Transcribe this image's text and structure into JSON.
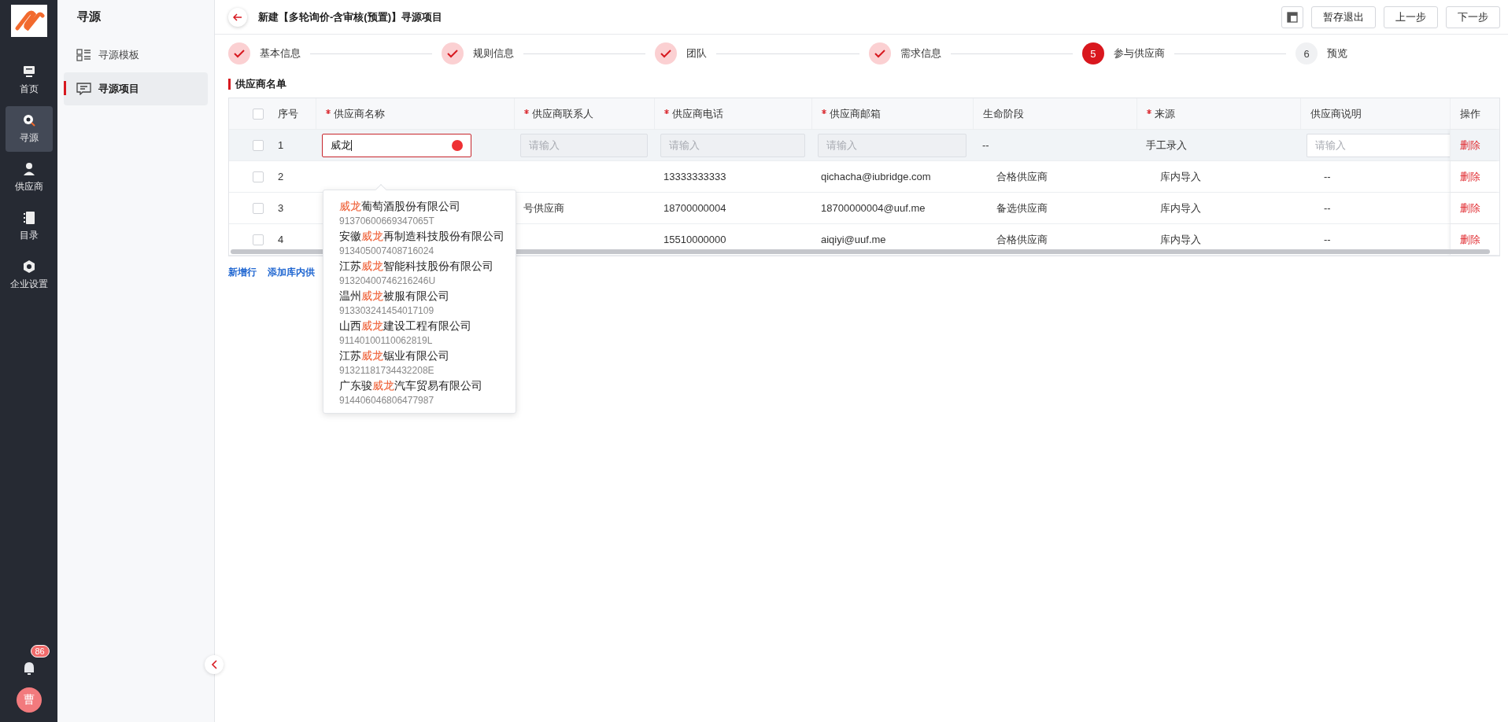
{
  "rail": {
    "items": [
      {
        "label": "首页",
        "selected": false
      },
      {
        "label": "寻源",
        "selected": true
      },
      {
        "label": "供应商",
        "selected": false
      },
      {
        "label": "目录",
        "selected": false
      },
      {
        "label": "企业设置",
        "selected": false
      }
    ],
    "notifications": "86",
    "avatar": "曹"
  },
  "subnav": {
    "title": "寻源",
    "items": [
      {
        "label": "寻源模板",
        "selected": false
      },
      {
        "label": "寻源项目",
        "selected": true
      }
    ]
  },
  "header": {
    "title": "新建【多轮询价-含审核(预置)】寻源项目",
    "buttons": [
      "暂存退出",
      "上一步",
      "下一步"
    ]
  },
  "steps": [
    {
      "label": "基本信息",
      "kind": "done"
    },
    {
      "label": "规则信息",
      "kind": "done"
    },
    {
      "label": "团队",
      "kind": "done"
    },
    {
      "label": "需求信息",
      "kind": "done"
    },
    {
      "label": "参与供应商",
      "kind": "current",
      "number": "5"
    },
    {
      "label": "预览",
      "kind": "pending",
      "number": "6"
    }
  ],
  "section_title": "供应商名单",
  "table": {
    "header_checked": false,
    "columns": [
      {
        "label": "序号",
        "required": false
      },
      {
        "label": "供应商名称",
        "required": true
      },
      {
        "label": "供应商联系人",
        "required": true
      },
      {
        "label": "供应商电话",
        "required": true
      },
      {
        "label": "供应商邮箱",
        "required": true
      },
      {
        "label": "生命阶段",
        "required": false
      },
      {
        "label": "来源",
        "required": true
      },
      {
        "label": "供应商说明",
        "required": false
      },
      {
        "label": "操作",
        "required": false
      }
    ],
    "rows": [
      {
        "checked": false,
        "editing": true,
        "cells": [
          "1",
          {
            "kind": "input",
            "value": "威龙",
            "focused": true,
            "disabled": false
          },
          {
            "kind": "input",
            "placeholder": "请输入",
            "focused": false,
            "disabled": true
          },
          {
            "kind": "input",
            "placeholder": "请输入",
            "focused": false,
            "disabled": true
          },
          {
            "kind": "input",
            "placeholder": "请输入",
            "focused": false,
            "disabled": true
          },
          "--",
          "手工录入",
          {
            "kind": "input",
            "placeholder": "请输入",
            "focused": false,
            "disabled": false
          },
          "删除"
        ]
      },
      {
        "checked": false,
        "editing": false,
        "cells": [
          "2",
          "",
          "",
          "13333333333",
          "qichacha@iubridge.com",
          "合格供应商",
          "库内导入",
          "--",
          "删除"
        ]
      },
      {
        "checked": false,
        "editing": false,
        "cells": [
          "3",
          "",
          "号供应商",
          "18700000004",
          "18700000004@uuf.me",
          "备选供应商",
          "库内导入",
          "--",
          "删除"
        ]
      },
      {
        "checked": false,
        "editing": false,
        "cells": [
          "4",
          "",
          "",
          "15510000000",
          "aiqiyi@uuf.me",
          "合格供应商",
          "库内导入",
          "--",
          "删除"
        ]
      }
    ]
  },
  "links": [
    "新增行",
    "添加库内供"
  ],
  "suggestions": [
    {
      "match": "威龙",
      "after": "葡萄酒股份有限公司",
      "code": "91370600669347065T"
    },
    {
      "before": "安徽",
      "match": "威龙",
      "after": "再制造科技股份有限公司",
      "code": "913405007408716024"
    },
    {
      "before": "江苏",
      "match": "威龙",
      "after": "智能科技股份有限公司",
      "code": "91320400746216246U"
    },
    {
      "before": "温州",
      "match": "威龙",
      "after": "被服有限公司",
      "code": "913303241454017109"
    },
    {
      "before": "山西",
      "match": "威龙",
      "after": "建设工程有限公司",
      "code": "91140100110062819L"
    },
    {
      "before": "江苏",
      "match": "威龙",
      "after": "锯业有限公司",
      "code": "91321181734432208E"
    },
    {
      "before": "广东骏",
      "match": "威龙",
      "after": "汽车贸易有限公司",
      "code": "914406046806477987"
    }
  ]
}
